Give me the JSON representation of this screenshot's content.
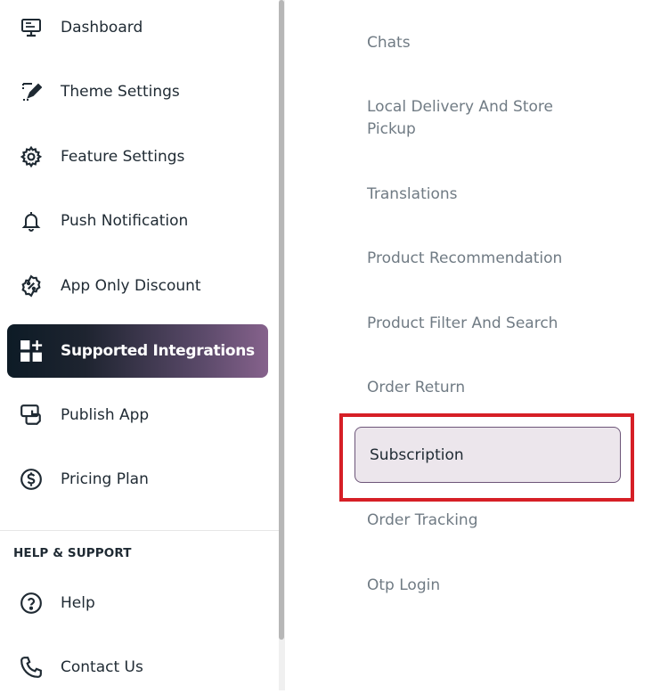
{
  "sidebar": {
    "items": [
      {
        "label": "Dashboard",
        "icon": "monitor-icon"
      },
      {
        "label": "Theme Settings",
        "icon": "theme-brush-icon"
      },
      {
        "label": "Feature Settings",
        "icon": "gear-icon"
      },
      {
        "label": "Push Notification",
        "icon": "bell-icon"
      },
      {
        "label": "App Only Discount",
        "icon": "discount-badge-icon"
      },
      {
        "label": "Supported Integrations",
        "icon": "integrations-grid-icon",
        "active": true
      },
      {
        "label": "Publish App",
        "icon": "publish-phone-icon"
      },
      {
        "label": "Pricing Plan",
        "icon": "dollar-circle-icon"
      }
    ],
    "help_section": {
      "title": "HELP & SUPPORT",
      "items": [
        {
          "label": "Help",
          "icon": "question-circle-icon"
        },
        {
          "label": "Contact Us",
          "icon": "phone-icon"
        }
      ]
    }
  },
  "integrations": {
    "items": [
      "Chats",
      "Local Delivery And Store Pickup",
      "Translations",
      "Product Recommendation",
      "Product Filter And Search",
      "Order Return",
      "Subscription",
      "Order Tracking",
      "Otp Login"
    ],
    "selected": "Subscription"
  },
  "colors": {
    "active_gradient_start": "#0d1b26",
    "active_gradient_end": "#86628c",
    "selected_bg": "#ece6ec",
    "selected_border": "#6c5578",
    "highlight_red": "#d61f26",
    "muted_text": "#707b84"
  }
}
